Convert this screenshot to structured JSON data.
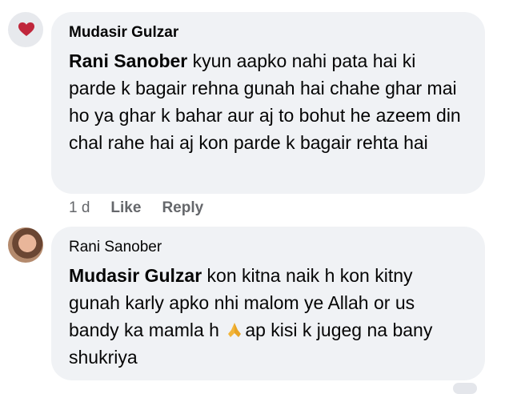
{
  "comments": [
    {
      "author": "Mudasir Gulzar",
      "mention": "Rani Sanober",
      "text": " kyun aapko nahi pata hai ki parde k bagair rehna gunah hai chahe ghar mai ho ya ghar k bahar aur aj to bohut he azeem din chal rahe hai aj kon parde k bagair rehta hai",
      "time": "1 d",
      "like_label": "Like",
      "reply_label": "Reply"
    },
    {
      "author": "Rani Sanober",
      "mention": "Mudasir Gulzar",
      "text_before_emoji": " kon kitna naik h kon kitny gunah karly apko nhi malom ye Allah or us bandy ka mamla h ",
      "emoji": "folded-hands-icon",
      "text_after_emoji": "ap kisi k jugeg na bany shukriya"
    }
  ],
  "colors": {
    "bubble": "#f0f2f5",
    "meta_text": "#65676b",
    "text": "#050505"
  }
}
